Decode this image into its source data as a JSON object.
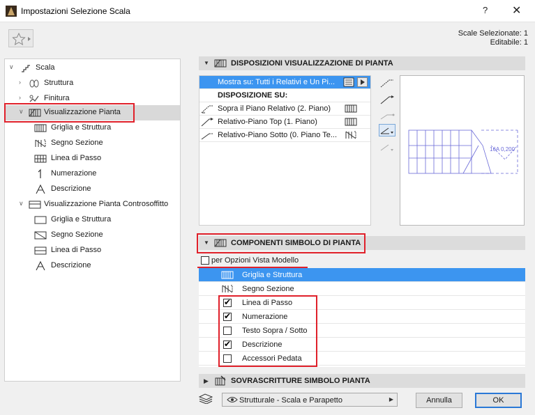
{
  "window": {
    "title": "Impostazioni Selezione Scala",
    "help": "?",
    "close": "✕"
  },
  "info": {
    "selected": "Scale Selezionate: 1",
    "editable": "Editabile: 1"
  },
  "tree": {
    "root": "Scala",
    "items": [
      {
        "label": "Struttura"
      },
      {
        "label": "Finitura"
      },
      {
        "label": "Visualizzazione Pianta"
      },
      {
        "label": "Griglia e Struttura"
      },
      {
        "label": "Segno Sezione"
      },
      {
        "label": "Linea di Passo"
      },
      {
        "label": "Numerazione"
      },
      {
        "label": "Descrizione"
      },
      {
        "label": "Visualizzazione Pianta Controsoffitto"
      },
      {
        "label": "Griglia e Struttura"
      },
      {
        "label": "Segno Sezione"
      },
      {
        "label": "Linea di Passo"
      },
      {
        "label": "Descrizione"
      }
    ]
  },
  "display_section": {
    "title": "DISPOSIZIONI VISUALIZZAZIONE DI PIANTA",
    "show_on": "Mostra su: Tutti i Relativi e Un Pi...",
    "layout_on": "DISPOSIZIONE SU:",
    "rows": [
      {
        "label": "Sopra il Piano Relativo (2. Piano)"
      },
      {
        "label": "Relativo-Piano Top (1. Piano)"
      },
      {
        "label": "Relativo-Piano Sotto (0. Piano Te..."
      }
    ]
  },
  "preview": {
    "label": "16A 0,200"
  },
  "components_section": {
    "title": "COMPONENTI SIMBOLO DI PIANTA",
    "model_view_option": "per Opzioni Vista Modello",
    "rows": [
      {
        "label": "Griglia e Struttura"
      },
      {
        "label": "Segno Sezione"
      },
      {
        "label": "Linea di Passo",
        "checked": true
      },
      {
        "label": "Numerazione",
        "checked": true
      },
      {
        "label": "Testo Sopra / Sotto",
        "checked": false
      },
      {
        "label": "Descrizione",
        "checked": true
      },
      {
        "label": "Accessori Pedata",
        "checked": false
      }
    ]
  },
  "overrides_section": {
    "title": "SOVRASCRITTURE SIMBOLO PIANTA"
  },
  "footer": {
    "model_view": "Strutturale - Scala e Parapetto",
    "cancel": "Annulla",
    "ok": "OK"
  },
  "colors": {
    "selection": "#3c95f0",
    "highlight": "#e0202a",
    "ok_border": "#2a78d6"
  }
}
